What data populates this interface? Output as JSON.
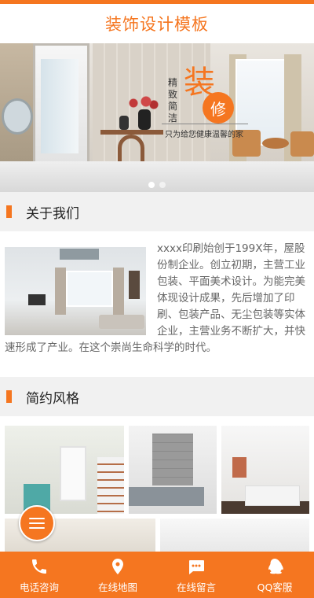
{
  "header": {
    "title": "装饰设计模板"
  },
  "banner": {
    "vertical_text": "精致简洁",
    "big_char": "装",
    "circle_char": "修",
    "subtitle": "只为给您健康温馨的家"
  },
  "about": {
    "heading": "关于我们",
    "text": "xxxx印刷始创于199X年，屋股份制企业。创立初期，主营工业包装、平面美术设计。为能完美体现设计成果，先后增加了印刷、包装产品、无尘包装等实体企业，主营业务不断扩大，并快速形成了产业。在这个崇尚生命科学的时代。"
  },
  "style_section": {
    "heading": "简约风格"
  },
  "bottom_nav": [
    {
      "label": "电话咨询",
      "icon": "phone-icon"
    },
    {
      "label": "在线地图",
      "icon": "map-pin-icon"
    },
    {
      "label": "在线留言",
      "icon": "message-icon"
    },
    {
      "label": "QQ客服",
      "icon": "qq-icon"
    }
  ],
  "colors": {
    "accent": "#f57620",
    "section_bg": "#f1f1f1",
    "text_gray": "#666666"
  }
}
